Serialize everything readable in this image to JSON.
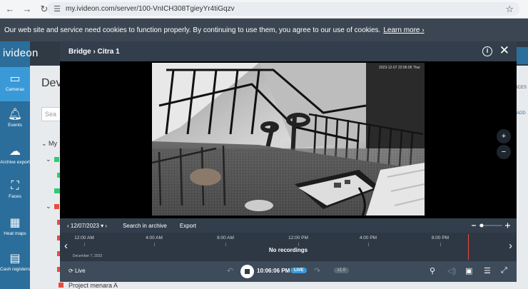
{
  "browser": {
    "url": "my.ivideon.com/server/100-VnICH308TgieyYr4tiGqzv"
  },
  "cookie": {
    "text": "Our web site and service need cookies to function properly. By continuing to use them, you agree to our use of cookies.",
    "link": "Learn more ›"
  },
  "app": {
    "logo": "ivideon"
  },
  "sidebar": {
    "items": [
      {
        "label": "Cameras",
        "icon": "camera-icon"
      },
      {
        "label": "Events",
        "icon": "bell-icon"
      },
      {
        "label": "Archive export",
        "icon": "cloud-download-icon"
      },
      {
        "label": "Faces",
        "icon": "face-scan-icon"
      },
      {
        "label": "Heat maps",
        "icon": "heatmap-icon"
      },
      {
        "label": "Cash registers",
        "icon": "calculator-icon"
      }
    ]
  },
  "background": {
    "devices_title": "Dev",
    "search_placeholder": "Sea",
    "tree_item_1": "My",
    "tree_item_last": "Project menara A",
    "right_tab": "ICES",
    "right_add": "ADD"
  },
  "modal": {
    "title": "Bridge › Citra 1",
    "video_timestamp": "2023-12-07   22:06:06   Thur",
    "controls": {
      "date": "12/07/2023",
      "search_archive": "Search in archive",
      "export": "Export"
    },
    "timeline": {
      "ticks": [
        "12:00 AM",
        "4:00 AM",
        "8:00 AM",
        "12:00 PM",
        "4:00 PM",
        "8:00 PM"
      ],
      "date_label": "December 7, 2023",
      "no_recordings": "No recordings"
    },
    "bottom": {
      "live_label": "Live",
      "time": "10:06:06 PM",
      "live_badge": "LIVE",
      "speed": "x1.0"
    }
  }
}
